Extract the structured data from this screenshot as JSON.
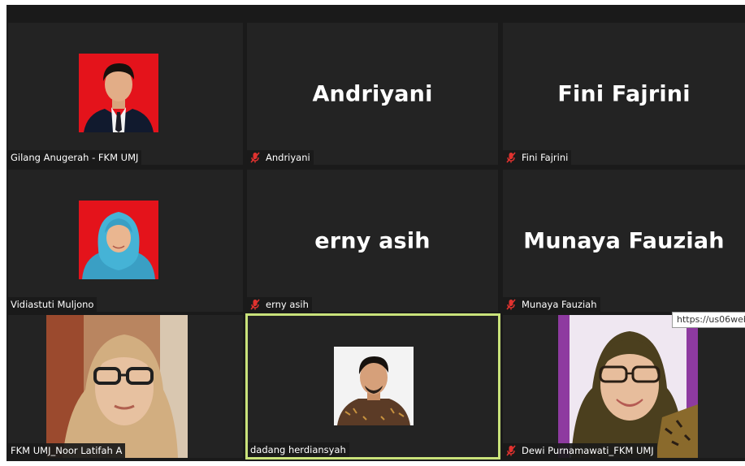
{
  "participants": [
    {
      "name": "Gilang Anugerah - FKM UMJ",
      "muted": false,
      "video": "photo"
    },
    {
      "name": "Andriyani",
      "muted": true,
      "video": "off"
    },
    {
      "name": "Fini Fajrini",
      "muted": true,
      "video": "off"
    },
    {
      "name": "Vidiastuti Muljono",
      "muted": false,
      "video": "photo"
    },
    {
      "name": "erny asih",
      "muted": true,
      "video": "off"
    },
    {
      "name": "Munaya Fauziah",
      "muted": true,
      "video": "off"
    },
    {
      "name": "FKM UMJ_Noor Latifah A",
      "muted": false,
      "video": "on"
    },
    {
      "name": "dadang herdiansyah",
      "muted": false,
      "video": "photo",
      "active_speaker": true
    },
    {
      "name": "Dewi Purnamawati_FKM UMJ",
      "muted": true,
      "video": "on"
    }
  ],
  "tooltip": {
    "text": "https://us06web"
  },
  "colors": {
    "background": "#1a1a1a",
    "tile": "#232323",
    "active_speaker_border": "#c9e27a",
    "mic_off": "#e0322f",
    "photo_red": "#e4131b"
  }
}
